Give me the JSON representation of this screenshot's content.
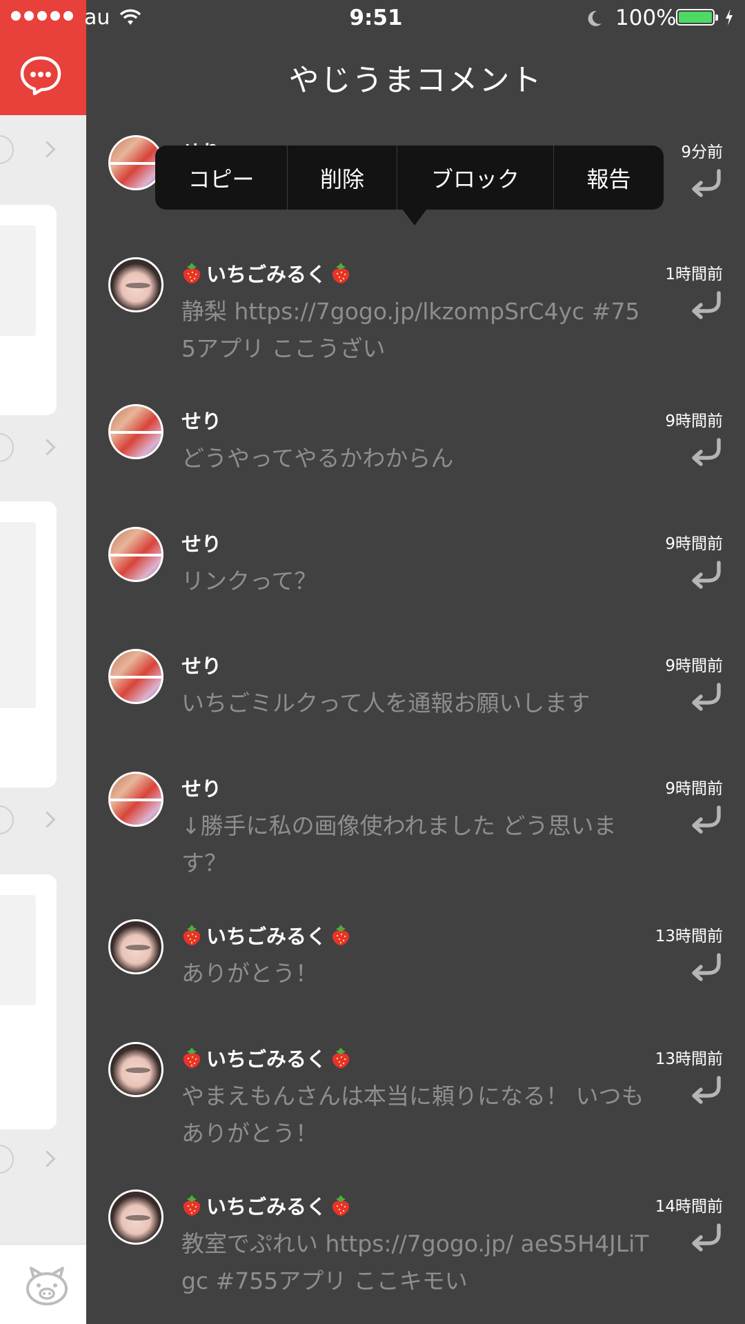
{
  "status_bar": {
    "carrier": "au",
    "time": "9:51",
    "battery": "100%"
  },
  "drawer": {
    "title": "やじうまコメント"
  },
  "context_menu": {
    "items": [
      "コピー",
      "削除",
      "ブロック",
      "報告"
    ]
  },
  "comments": [
    {
      "author": "せり",
      "avatar": "seri",
      "time": "9分前",
      "text": ""
    },
    {
      "author": "いちごみるく",
      "avatar": "ichigo",
      "time": "1時間前",
      "text": "静梨 https://7gogo.jp/lkzompSrC4yc #755アプリ ここうざい"
    },
    {
      "author": "せり",
      "avatar": "seri",
      "time": "9時間前",
      "text": "どうやってやるかわからん"
    },
    {
      "author": "せり",
      "avatar": "seri",
      "time": "9時間前",
      "text": "リンクって？"
    },
    {
      "author": "せり",
      "avatar": "seri",
      "time": "9時間前",
      "text": "いちごミルクって人を通報お願いします"
    },
    {
      "author": "せり",
      "avatar": "seri",
      "time": "9時間前",
      "text": "↓勝手に私の画像使われました どう思いま す？"
    },
    {
      "author": "いちごみるく",
      "avatar": "ichigo",
      "time": "13時間前",
      "text": "ありがとう！"
    },
    {
      "author": "いちごみるく",
      "avatar": "ichigo",
      "time": "13時間前",
      "text": "やまえもんさんは本当に頼りになる！ いつも ありがとう！"
    },
    {
      "author": "いちごみるく",
      "avatar": "ichigo",
      "time": "14時間前",
      "text": "教室でぷれい https://7gogo.jp/ aeS5H4JLiTgc #755アプリ ここキモい"
    }
  ]
}
